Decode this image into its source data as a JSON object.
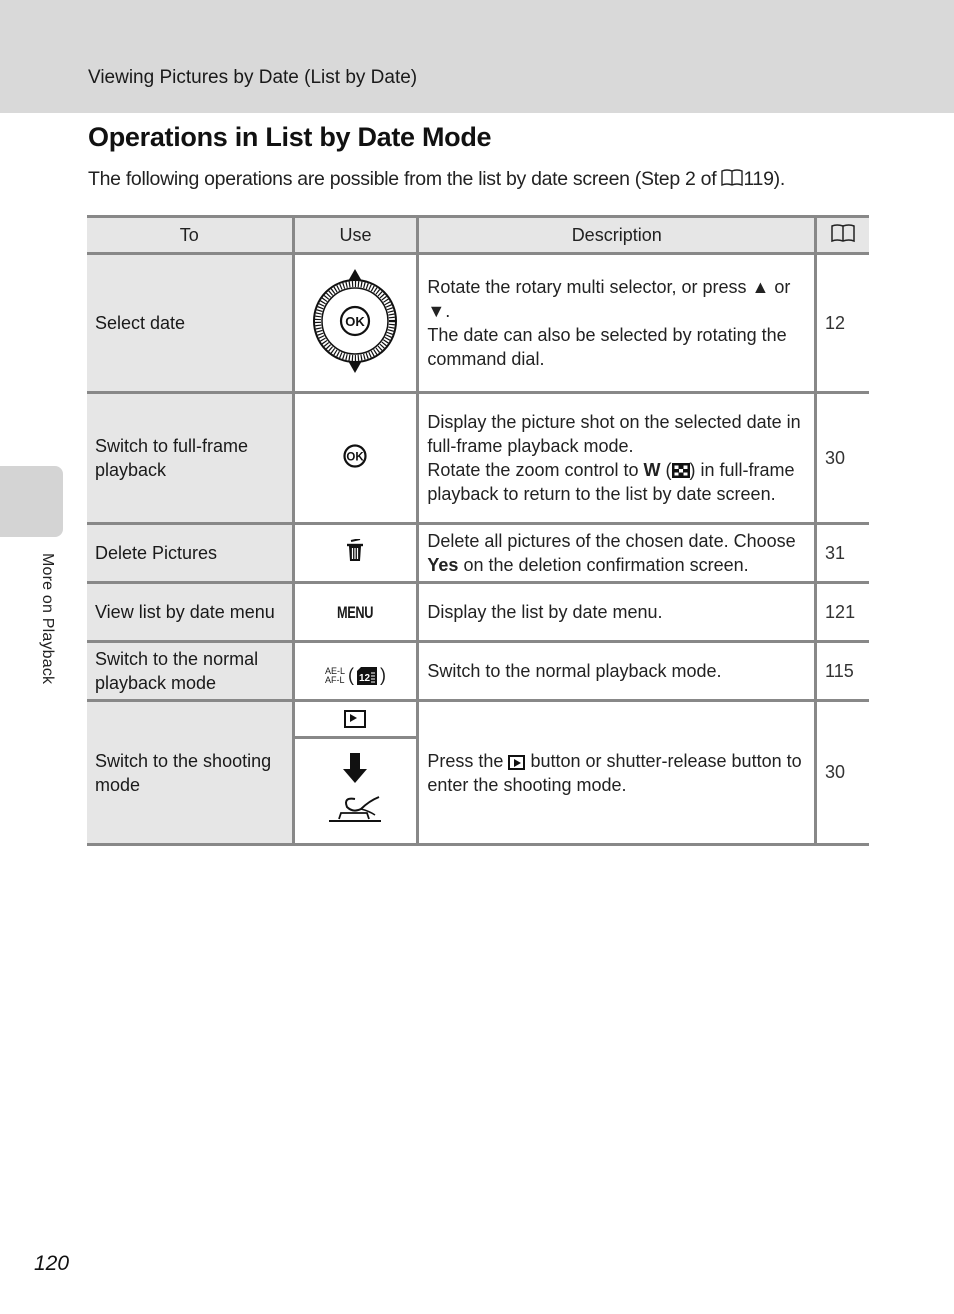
{
  "header": {
    "running_head": "Viewing Pictures by Date (List by Date)"
  },
  "side_tab": {
    "label": "More on Playback"
  },
  "section": {
    "title": "Operations in List by Date Mode",
    "intro_before": "The following operations are possible from the list by date screen (Step 2 of ",
    "intro_ref_icon": "book-icon",
    "intro_page_ref": "119",
    "intro_after": ")."
  },
  "table": {
    "headers": {
      "to": "To",
      "use": "Use",
      "description": "Description",
      "page_icon": "book-icon"
    },
    "rows": [
      {
        "to": "Select date",
        "use_icon": "rotary-multi-selector-icon",
        "description_parts": [
          "Rotate the rotary multi selector, or press ",
          " or ",
          ".",
          "The date can also be selected by rotating the command dial."
        ],
        "description_icons": [
          "up-triangle-icon",
          "down-triangle-icon"
        ],
        "page": "12"
      },
      {
        "to": "Switch to full-frame playback",
        "use_icon": "ok-button-icon",
        "description_line1": "Display the picture shot on the selected date in full-frame playback mode.",
        "description_line2_before": "Rotate the zoom control to ",
        "description_w": "W",
        "description_line2_after": ") in full-frame playback to return to the list by date screen.",
        "description_icon": "thumbnail-grid-icon",
        "page": "30"
      },
      {
        "to": "Delete Pictures",
        "use_icon": "trash-icon",
        "description_before": "Delete all pictures of the chosen date. Choose ",
        "description_bold": "Yes",
        "description_after": " on the deletion confirmation screen.",
        "page": "31"
      },
      {
        "to": "View list by date menu",
        "use_label": "MENU",
        "description": "Display the list by date menu.",
        "page": "121"
      },
      {
        "to": "Switch to the normal playback mode",
        "use_label_top": "AE-L",
        "use_label_bottom": "AF-L",
        "use_icon": "list-by-date-icon",
        "use_icon_text": "12",
        "description": "Switch to the normal playback mode.",
        "page": "115"
      },
      {
        "to": "Switch to the shooting mode",
        "use_icons": [
          "playback-button-icon",
          "shutter-release-button-icon"
        ],
        "description_before": "Press the ",
        "description_icon": "playback-button-icon",
        "description_after": " button or shutter-release button to enter the shooting mode.",
        "page": "30"
      }
    ]
  },
  "footer": {
    "page_number": "120"
  }
}
